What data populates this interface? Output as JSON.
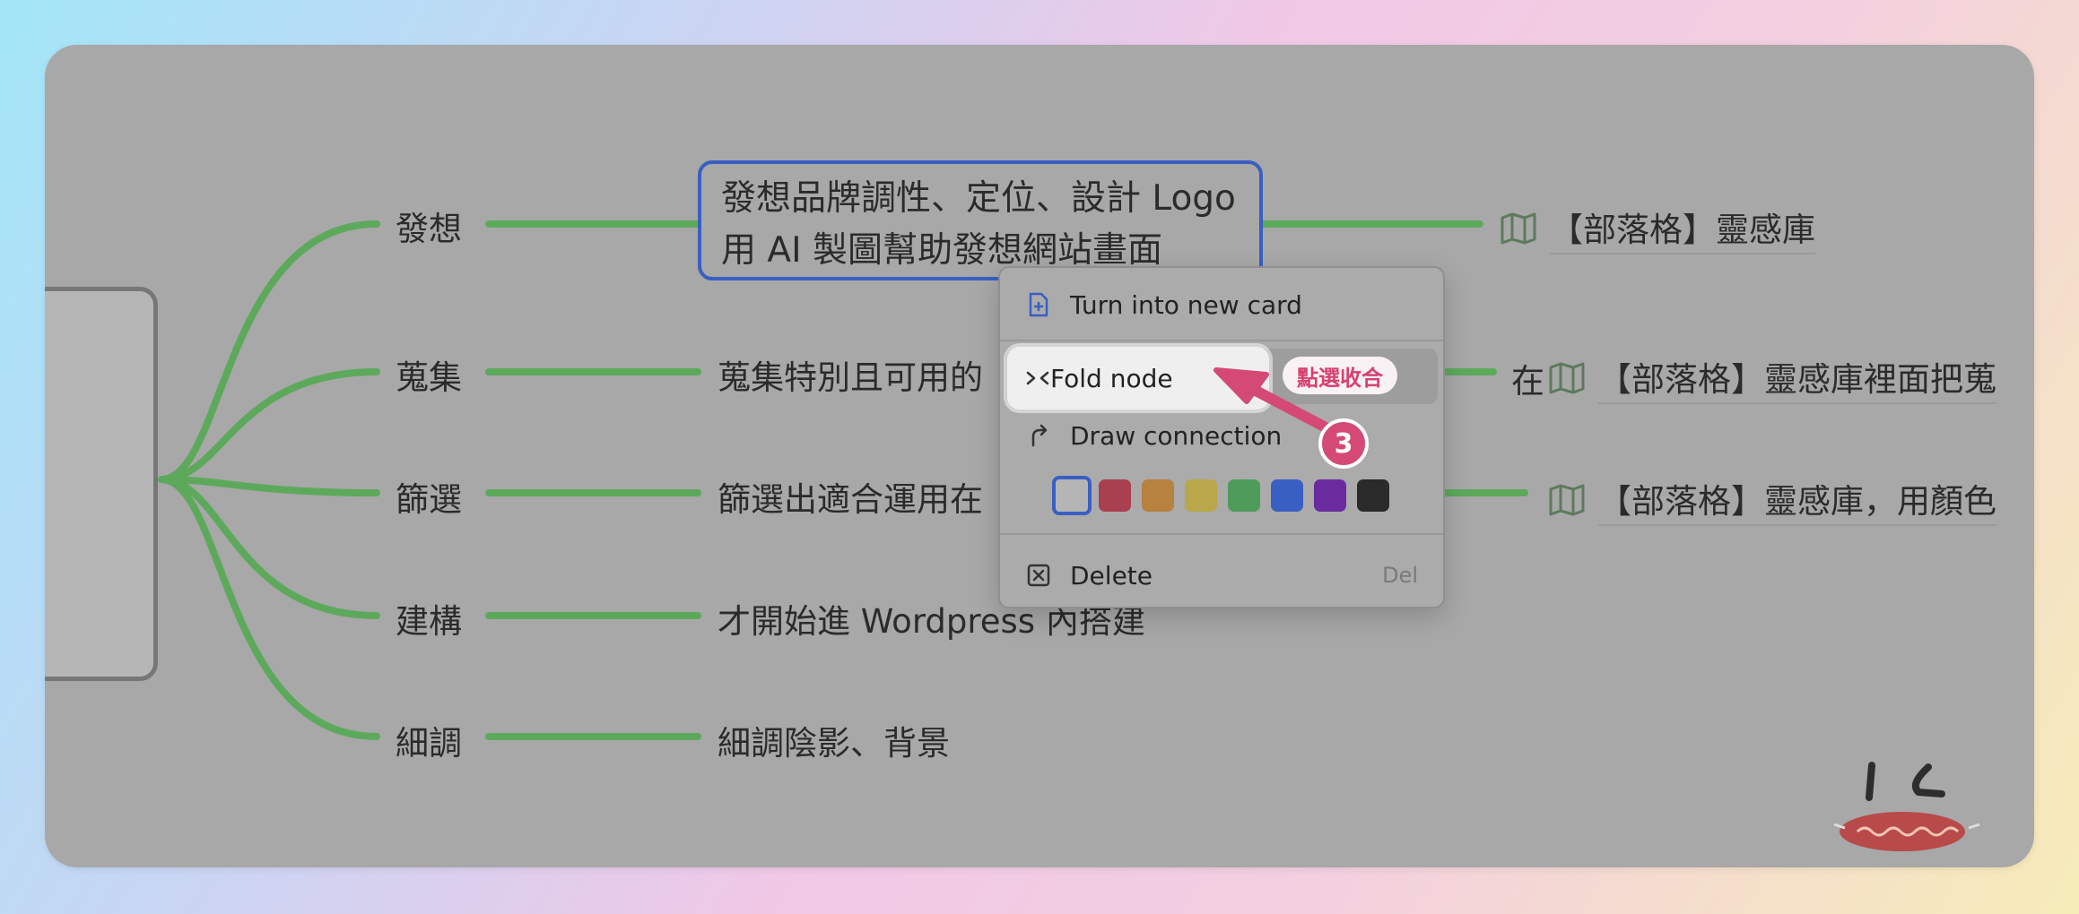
{
  "branches": [
    {
      "label": "發想"
    },
    {
      "label": "蒐集",
      "text": "蒐集特別且可用的"
    },
    {
      "label": "篩選",
      "text": "篩選出適合運用在"
    },
    {
      "label": "建構",
      "text": "才開始進 Wordpress 內搭建"
    },
    {
      "label": "細調",
      "text": "細調陰影、背景"
    }
  ],
  "selected_node": {
    "line1": "發想品牌調性、定位、設計 Logo",
    "line2": "用 AI 製圖幫助發想網站畫面"
  },
  "links": [
    {
      "prefix": "",
      "text": "【部落格】靈感庫"
    },
    {
      "prefix": "在",
      "text": "【部落格】靈感庫裡面把蒐"
    },
    {
      "prefix": "",
      "text": "【部落格】靈感庫，用顏色"
    }
  ],
  "context_menu": {
    "turn_into_card": "Turn into new card",
    "fold_node": "Fold node",
    "draw_connection": "Draw connection",
    "delete": "Delete",
    "delete_shortcut": "Del",
    "colors": [
      "#b5b5b5",
      "#a8404f",
      "#b7813f",
      "#b9a84b",
      "#4f9b5a",
      "#3a5fc2",
      "#6a2b9e",
      "#2a2a2a"
    ]
  },
  "annotation": {
    "tag": "點選收合",
    "step": "3"
  },
  "theme": {
    "edge_color": "#5da95c",
    "accent": "#3a5fc2",
    "annotation_color": "#d44a75"
  }
}
